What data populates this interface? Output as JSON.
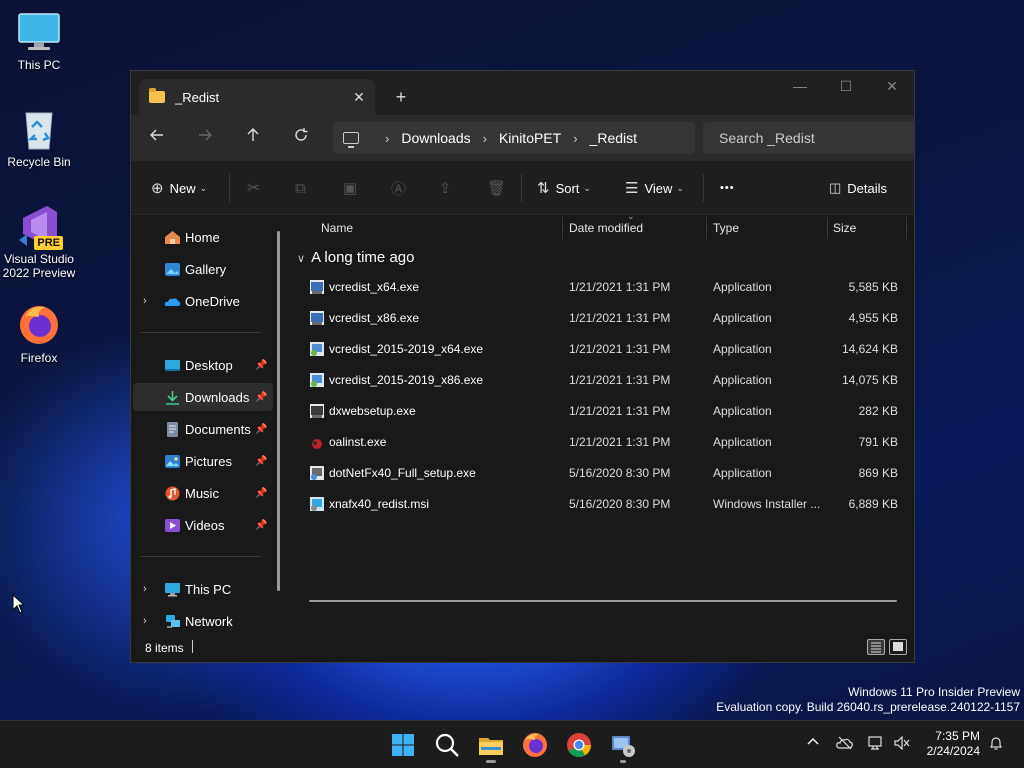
{
  "desktop": {
    "icons": [
      {
        "label": "This PC",
        "icon": "monitor-icon"
      },
      {
        "label": "Recycle Bin",
        "icon": "recycle-bin-icon"
      },
      {
        "label": "Visual Studio\n2022 Preview",
        "line1": "Visual Studio",
        "line2": "2022 Preview",
        "badge": "PRE",
        "icon": "visual-studio-icon"
      },
      {
        "label": "Firefox",
        "icon": "firefox-icon"
      }
    ],
    "watermark": {
      "line1": "Windows 11 Pro Insider Preview",
      "line2": "Evaluation copy. Build 26040.rs_prerelease.240122-1157"
    }
  },
  "window": {
    "tab_title": "_Redist",
    "new_tab": "+",
    "close_tab": "✕",
    "controls": {
      "minimize": "—",
      "maximize": "☐",
      "close": "✕"
    },
    "breadcrumb": [
      "Downloads",
      "KinitoPET",
      "_Redist"
    ],
    "search_placeholder": "Search _Redist",
    "toolbar": {
      "new_label": "New",
      "sort_label": "Sort",
      "view_label": "View",
      "more_label": "•••",
      "details_label": "Details"
    },
    "nav": {
      "home": "Home",
      "gallery": "Gallery",
      "onedrive": "OneDrive",
      "desktop": "Desktop",
      "downloads": "Downloads",
      "documents": "Documents",
      "pictures": "Pictures",
      "music": "Music",
      "videos": "Videos",
      "this_pc": "This PC",
      "network": "Network"
    },
    "columns": {
      "name": "Name",
      "date": "Date modified",
      "type": "Type",
      "size": "Size"
    },
    "group_label": "A long time ago",
    "files": [
      {
        "name": "vcredist_x64.exe",
        "date": "1/21/2021 1:31 PM",
        "type": "Application",
        "size": "5,585 KB"
      },
      {
        "name": "vcredist_x86.exe",
        "date": "1/21/2021 1:31 PM",
        "type": "Application",
        "size": "4,955 KB"
      },
      {
        "name": "vcredist_2015-2019_x64.exe",
        "date": "1/21/2021 1:31 PM",
        "type": "Application",
        "size": "14,624 KB"
      },
      {
        "name": "vcredist_2015-2019_x86.exe",
        "date": "1/21/2021 1:31 PM",
        "type": "Application",
        "size": "14,075 KB"
      },
      {
        "name": "dxwebsetup.exe",
        "date": "1/21/2021 1:31 PM",
        "type": "Application",
        "size": "282 KB"
      },
      {
        "name": "oalinst.exe",
        "date": "1/21/2021 1:31 PM",
        "type": "Application",
        "size": "791 KB"
      },
      {
        "name": "dotNetFx40_Full_setup.exe",
        "date": "5/16/2020 8:30 PM",
        "type": "Application",
        "size": "869 KB"
      },
      {
        "name": "xnafx40_redist.msi",
        "date": "5/16/2020 8:30 PM",
        "type": "Windows Installer ...",
        "size": "6,889 KB"
      }
    ],
    "status_count": "8 items"
  },
  "taskbar": {
    "time": "7:35 PM",
    "date": "2/24/2024",
    "tray_chevron": "^"
  },
  "colors": {
    "accent": "#4cc2ff",
    "folder": "#f3c34b"
  }
}
